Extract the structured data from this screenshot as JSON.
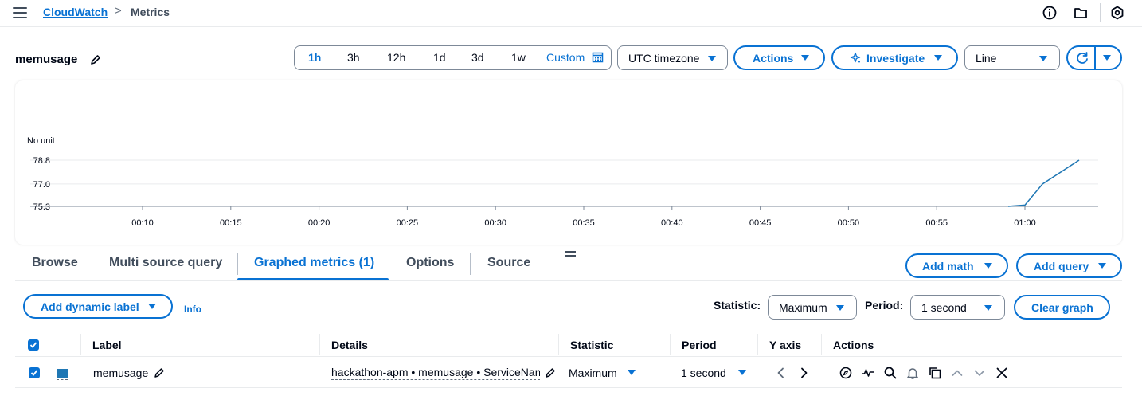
{
  "breadcrumb": {
    "root": "CloudWatch",
    "separator": ">",
    "current": "Metrics"
  },
  "page": {
    "title": "memusage"
  },
  "time_range": {
    "options": [
      "1h",
      "3h",
      "12h",
      "1d",
      "3d",
      "1w"
    ],
    "selected": "1h",
    "custom_label": "Custom"
  },
  "timezone": {
    "value": "UTC timezone"
  },
  "toolbar": {
    "actions_label": "Actions",
    "investigate_label": "Investigate",
    "chart_type": "Line"
  },
  "chart_data": {
    "type": "line",
    "ylabel": "No unit",
    "y_ticks": [
      "78.8",
      "77.0",
      "75.3"
    ],
    "ylim": [
      75.3,
      78.8
    ],
    "x_ticks": [
      "00:10",
      "00:15",
      "00:20",
      "00:25",
      "00:30",
      "00:35",
      "00:40",
      "00:45",
      "00:50",
      "00:55",
      "01:00"
    ],
    "series": [
      {
        "values": [
          {
            "t": "00:59",
            "v": 75.3
          },
          {
            "t": "01:00",
            "v": 75.4
          },
          {
            "t": "01:01",
            "v": 77.0
          },
          {
            "t": "01:03",
            "v": 78.8
          }
        ]
      }
    ],
    "grid": true,
    "colors": {
      "line": "#1f77b4"
    }
  },
  "tabs": [
    "Browse",
    "Multi source query",
    "Graphed metrics (1)",
    "Options",
    "Source"
  ],
  "active_tab": "Graphed metrics (1)",
  "panel": {
    "add_math_label": "Add math",
    "add_query_label": "Add query",
    "add_dynamic_label": "Add dynamic label",
    "info_label": "Info",
    "statistic_label": "Statistic:",
    "statistic_value": "Maximum",
    "period_label": "Period:",
    "period_value": "1 second",
    "clear_graph_label": "Clear graph"
  },
  "table": {
    "headers": [
      "Label",
      "Details",
      "Statistic",
      "Period",
      "Y axis",
      "Actions"
    ],
    "rows": [
      {
        "label": "memusage",
        "details": "hackathon-apm • memusage • ServiceName",
        "statistic": "Maximum",
        "period": "1 second",
        "color": "#1f77b4"
      }
    ]
  },
  "colors": {
    "accent": "#0972d3",
    "text": "#000716"
  },
  "icons": [
    "menu-icon",
    "info-icon",
    "folder-icon",
    "settings-icon",
    "edit-icon",
    "calendar-icon",
    "sparkle-icon",
    "refresh-icon",
    "chevron-left-icon",
    "chevron-right-icon",
    "compass-icon",
    "pulse-icon",
    "search-icon",
    "bell-icon",
    "copy-icon",
    "chevron-up-icon",
    "chevron-down-icon",
    "close-icon"
  ]
}
